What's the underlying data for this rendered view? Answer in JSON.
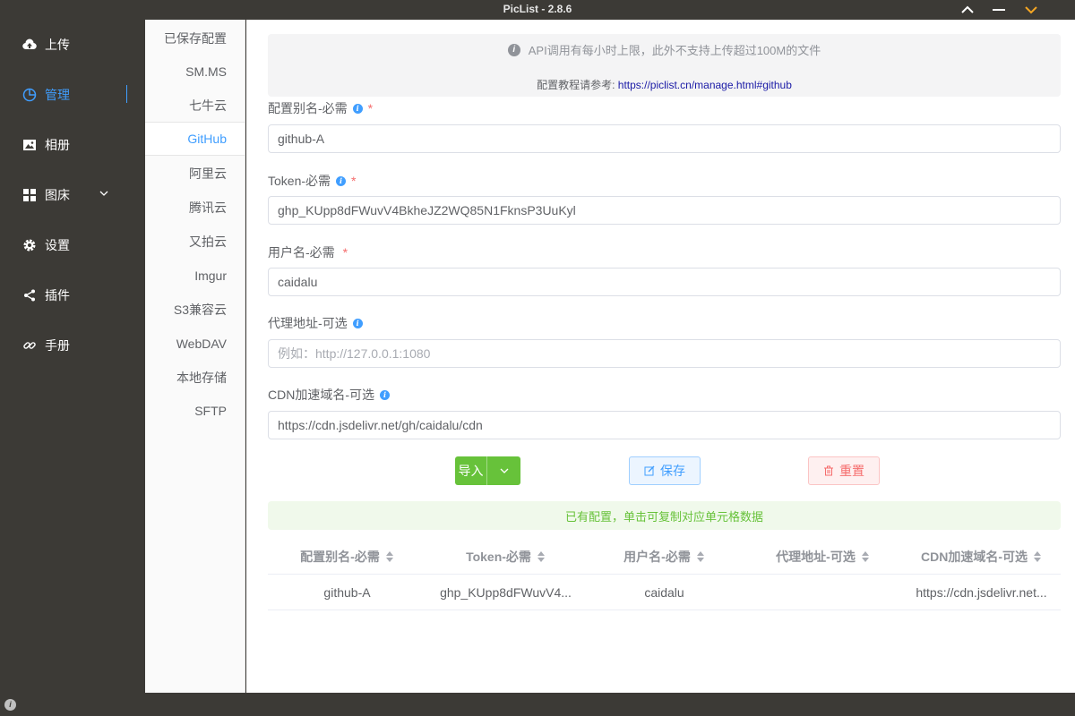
{
  "window": {
    "title": "PicList - 2.8.6",
    "controls": [
      "chevron-up-icon",
      "minimize-icon",
      "chevron-down-icon"
    ],
    "accent_color": "#f5a623"
  },
  "sidebar": {
    "items": [
      {
        "label": "上传",
        "icon": "cloud-upload-icon",
        "active": false
      },
      {
        "label": "管理",
        "icon": "pie-chart-icon",
        "active": true
      },
      {
        "label": "相册",
        "icon": "image-icon",
        "active": false
      },
      {
        "label": "图床",
        "icon": "grid-icon",
        "active": false,
        "expandable": true
      },
      {
        "label": "设置",
        "icon": "gear-icon",
        "active": false
      },
      {
        "label": "插件",
        "icon": "share-icon",
        "active": false
      },
      {
        "label": "手册",
        "icon": "link-icon",
        "active": false
      }
    ],
    "active_color": "#409eff"
  },
  "picbeds": {
    "items": [
      {
        "label": "已保存配置",
        "active": false
      },
      {
        "label": "SM.MS",
        "active": false
      },
      {
        "label": "七牛云",
        "active": false
      },
      {
        "label": "GitHub",
        "active": true
      },
      {
        "label": "阿里云",
        "active": false
      },
      {
        "label": "腾讯云",
        "active": false
      },
      {
        "label": "又拍云",
        "active": false
      },
      {
        "label": "Imgur",
        "active": false
      },
      {
        "label": "S3兼容云",
        "active": false
      },
      {
        "label": "WebDAV",
        "active": false
      },
      {
        "label": "本地存储",
        "active": false
      },
      {
        "label": "SFTP",
        "active": false
      }
    ]
  },
  "notice": {
    "text": "API调用有每小时上限，此外不支持上传超过100M的文件",
    "tutorial_prefix": "配置教程请参考: ",
    "tutorial_link": "https://piclist.cn/manage.html#github"
  },
  "form": {
    "alias": {
      "label": "配置别名-必需",
      "required": "*",
      "value": "github-A",
      "placeholder": ""
    },
    "token": {
      "label": "Token-必需",
      "required": "*",
      "value": "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",
      "placeholder": ""
    },
    "username": {
      "label": "用户名-必需",
      "required": "*",
      "value": "caidalu",
      "placeholder": ""
    },
    "proxy": {
      "label": "代理地址-可选",
      "value": "",
      "placeholder": "例如：http://127.0.0.1:1080"
    },
    "cdn": {
      "label": "CDN加速域名-可选",
      "value": "https://cdn.jsdelivr.net/gh/caidalu/cdn",
      "placeholder": ""
    }
  },
  "buttons": {
    "import": "导入",
    "save": "保存",
    "reset": "重置"
  },
  "success_message": "已有配置，单击可复制对应单元格数据",
  "table": {
    "headers": [
      "配置别名-必需",
      "Token-必需",
      "用户名-必需",
      "代理地址-可选",
      "CDN加速域名-可选"
    ],
    "rows": [
      [
        "github-A",
        "ghp_KUpp8dFWuvV4...",
        "caidalu",
        "",
        "https://cdn.jsdelivr.net..."
      ]
    ]
  }
}
